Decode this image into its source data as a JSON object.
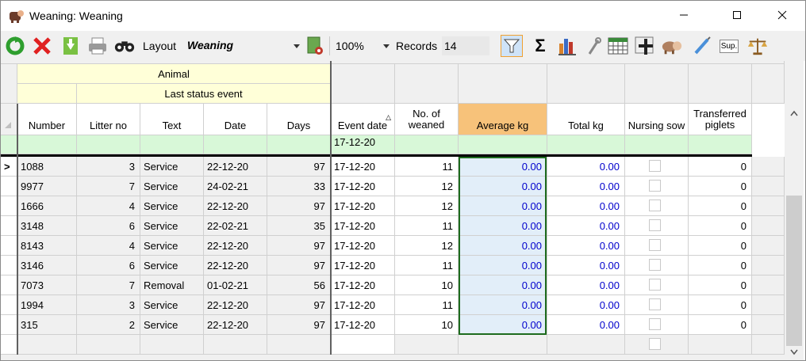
{
  "window": {
    "title": "Weaning: Weaning"
  },
  "toolbar": {
    "layout_label": "Layout",
    "layout_value": "Weaning",
    "zoom_value": "100%",
    "records_label": "Records",
    "records_value": "14",
    "sup_label": "Sup."
  },
  "grid": {
    "group_header": "Animal",
    "subgroup_header": "Last status event",
    "columns": [
      "Number",
      "Litter no",
      "Text",
      "Date",
      "Days",
      "Event date",
      "No. of\nweaned",
      "Average kg",
      "Total kg",
      "Nursing sow",
      "Transferred\npiglets"
    ],
    "filter_event_date": "17-12-20",
    "current_row_marker": ">",
    "rows": [
      {
        "number": "1088",
        "litter": "3",
        "text": "Service",
        "date": "22-12-20",
        "days": "97",
        "event_date": "17-12-20",
        "weaned": "11",
        "avg": "0.00",
        "total": "0.00",
        "transferred": "0"
      },
      {
        "number": "9977",
        "litter": "7",
        "text": "Service",
        "date": "24-02-21",
        "days": "33",
        "event_date": "17-12-20",
        "weaned": "12",
        "avg": "0.00",
        "total": "0.00",
        "transferred": "0"
      },
      {
        "number": "1666",
        "litter": "4",
        "text": "Service",
        "date": "22-12-20",
        "days": "97",
        "event_date": "17-12-20",
        "weaned": "12",
        "avg": "0.00",
        "total": "0.00",
        "transferred": "0"
      },
      {
        "number": "3148",
        "litter": "6",
        "text": "Service",
        "date": "22-02-21",
        "days": "35",
        "event_date": "17-12-20",
        "weaned": "11",
        "avg": "0.00",
        "total": "0.00",
        "transferred": "0"
      },
      {
        "number": "8143",
        "litter": "4",
        "text": "Service",
        "date": "22-12-20",
        "days": "97",
        "event_date": "17-12-20",
        "weaned": "12",
        "avg": "0.00",
        "total": "0.00",
        "transferred": "0"
      },
      {
        "number": "3146",
        "litter": "6",
        "text": "Service",
        "date": "22-12-20",
        "days": "97",
        "event_date": "17-12-20",
        "weaned": "11",
        "avg": "0.00",
        "total": "0.00",
        "transferred": "0"
      },
      {
        "number": "7073",
        "litter": "7",
        "text": "Removal",
        "date": "01-02-21",
        "days": "56",
        "event_date": "17-12-20",
        "weaned": "10",
        "avg": "0.00",
        "total": "0.00",
        "transferred": "0"
      },
      {
        "number": "1994",
        "litter": "3",
        "text": "Service",
        "date": "22-12-20",
        "days": "97",
        "event_date": "17-12-20",
        "weaned": "11",
        "avg": "0.00",
        "total": "0.00",
        "transferred": "0"
      },
      {
        "number": "315",
        "litter": "2",
        "text": "Service",
        "date": "22-12-20",
        "days": "97",
        "event_date": "17-12-20",
        "weaned": "10",
        "avg": "0.00",
        "total": "0.00",
        "transferred": "0"
      }
    ]
  },
  "colors": {
    "group_header_bg": "#ffffd8",
    "filter_row_bg": "#d8f8d8",
    "avg_header_bg": "#f7c27a",
    "value_blue": "#0000cc",
    "focus_border": "#1e6b1e"
  }
}
